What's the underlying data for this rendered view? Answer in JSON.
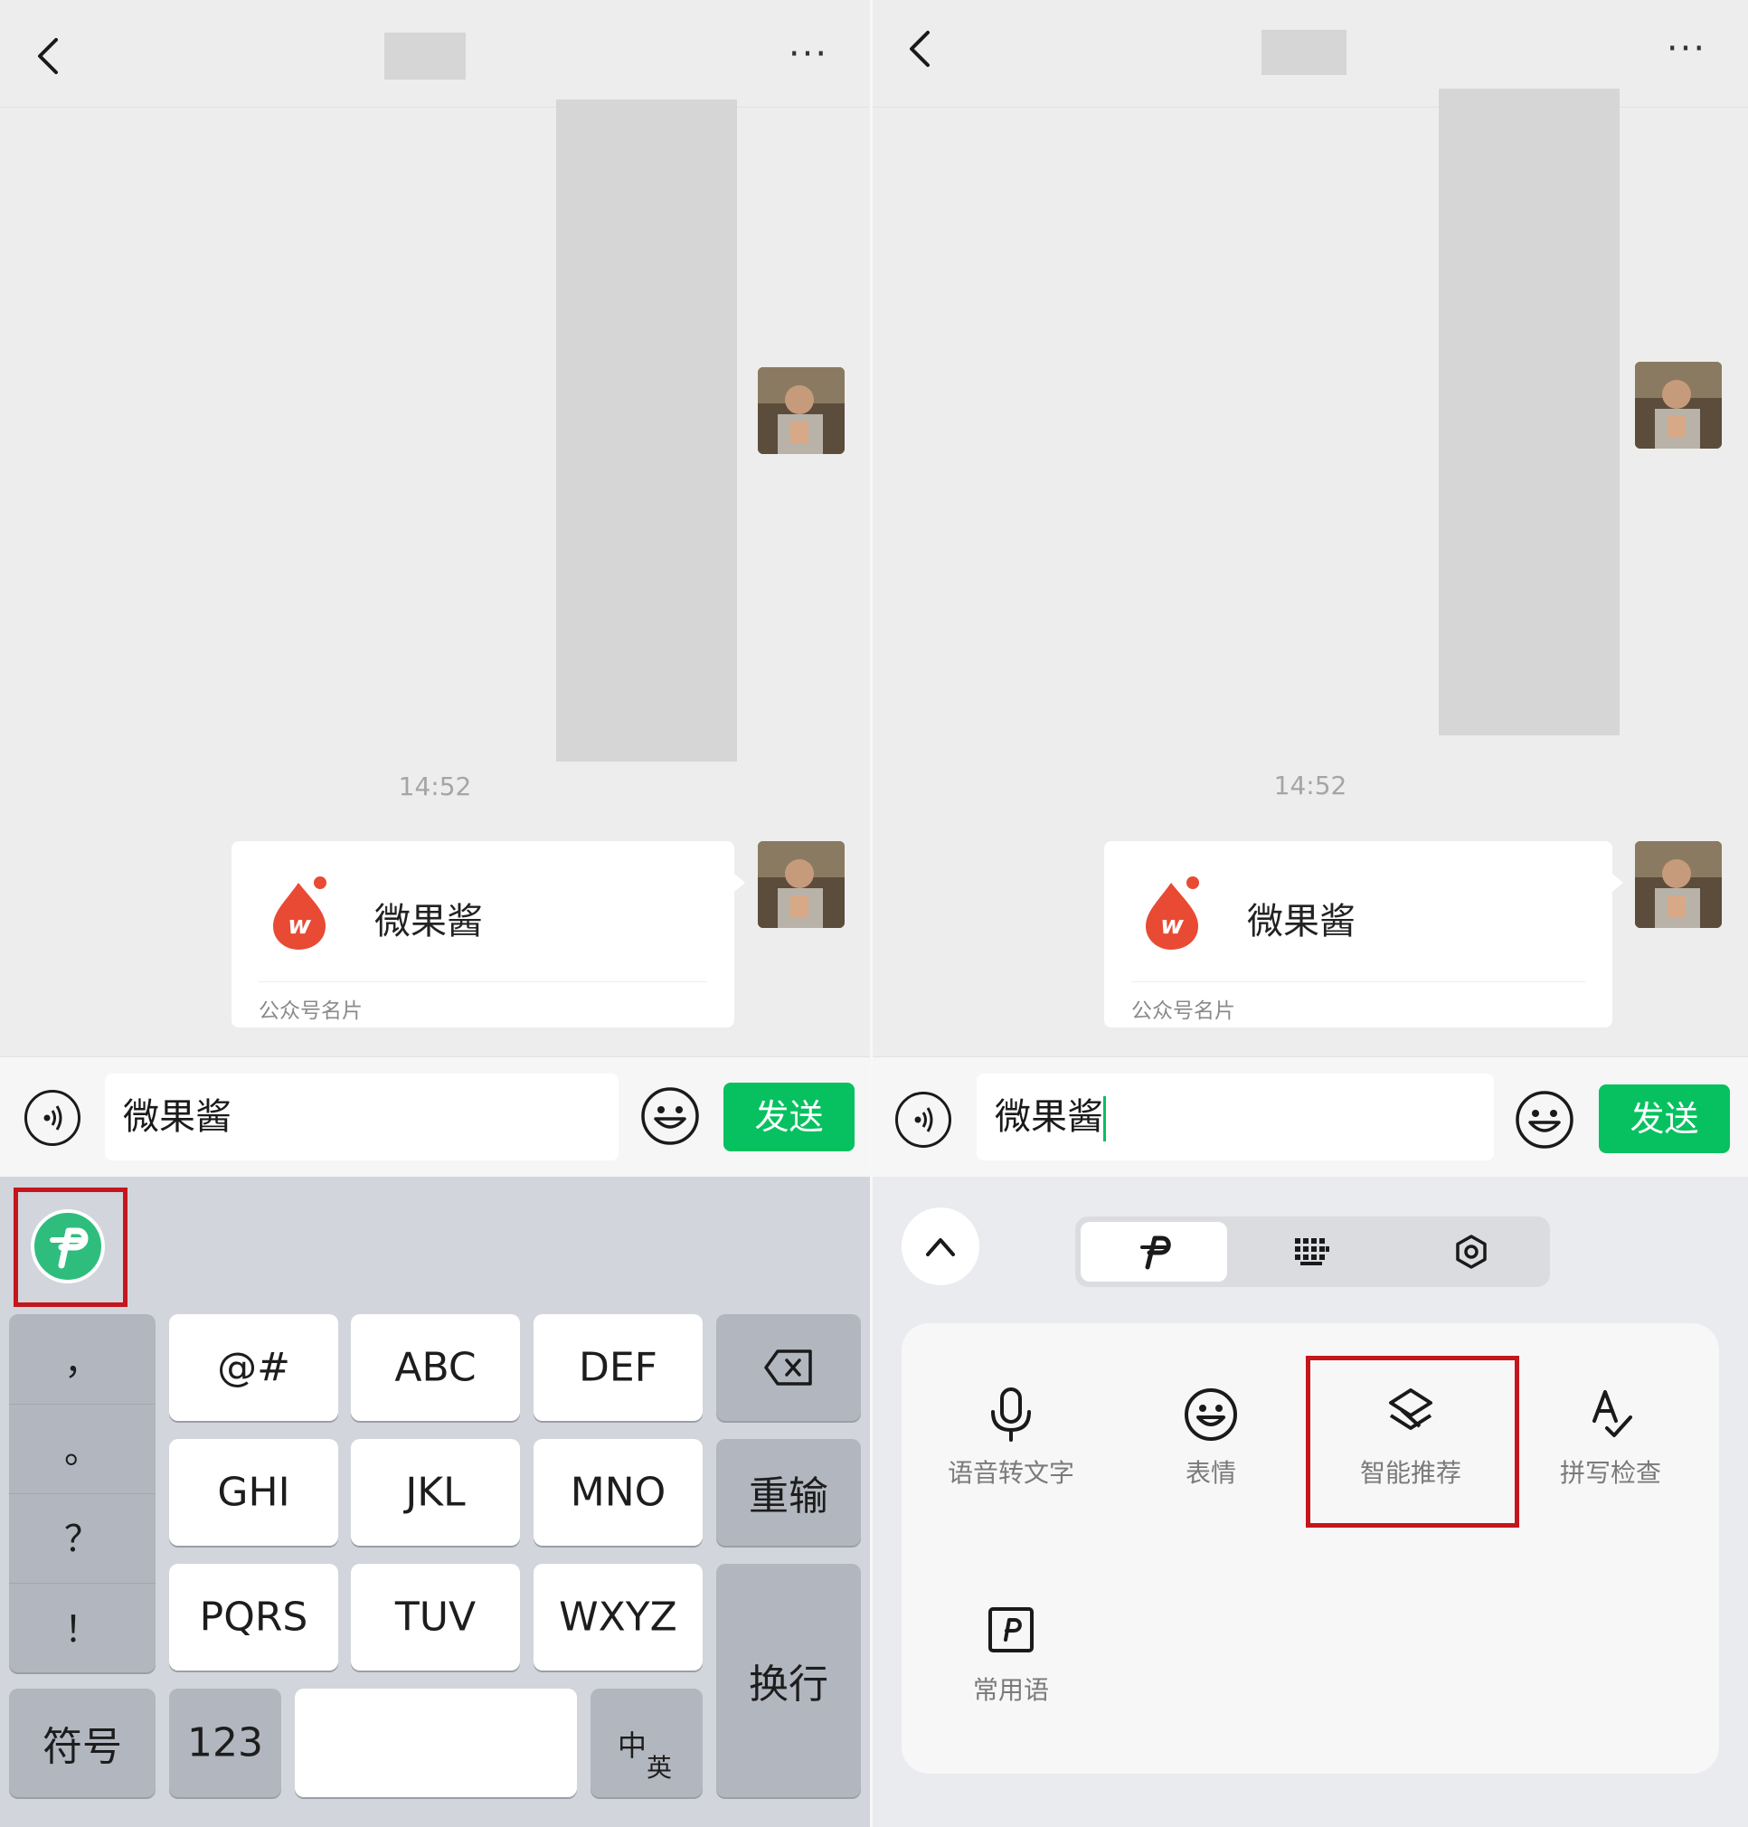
{
  "chat": {
    "time": "14:52",
    "card": {
      "name": "微果酱",
      "type_label": "公众号名片",
      "logo_letter": "w"
    }
  },
  "header": {
    "more_label": "···"
  },
  "input": {
    "value_left": "微果酱",
    "value_right": "微果酱",
    "send_label": "发送"
  },
  "keyboard_left": {
    "symbols": [
      "，",
      "。",
      "？",
      "！"
    ],
    "row1": [
      "@#",
      "ABC",
      "DEF"
    ],
    "row2": [
      "GHI",
      "JKL",
      "MNO"
    ],
    "row3": [
      "PQRS",
      "TUV",
      "WXYZ"
    ],
    "reenter_label": "重输",
    "newline_label": "换行",
    "symbol_label": "符号",
    "num_label": "123",
    "lang_top": "中",
    "lang_bottom": "英"
  },
  "keyboard_right": {
    "tools": [
      {
        "label": "语音转文字",
        "icon": "microphone-icon"
      },
      {
        "label": "表情",
        "icon": "emoji-icon"
      },
      {
        "label": "智能推荐",
        "icon": "smart-recommend-icon"
      },
      {
        "label": "拼写检查",
        "icon": "spell-check-icon"
      },
      {
        "label": "常用语",
        "icon": "phrases-icon"
      }
    ]
  },
  "colors": {
    "send_green": "#07c160",
    "ime_green": "#2fbd7d",
    "highlight_red": "#c4161c",
    "logo_red": "#e84a34"
  }
}
